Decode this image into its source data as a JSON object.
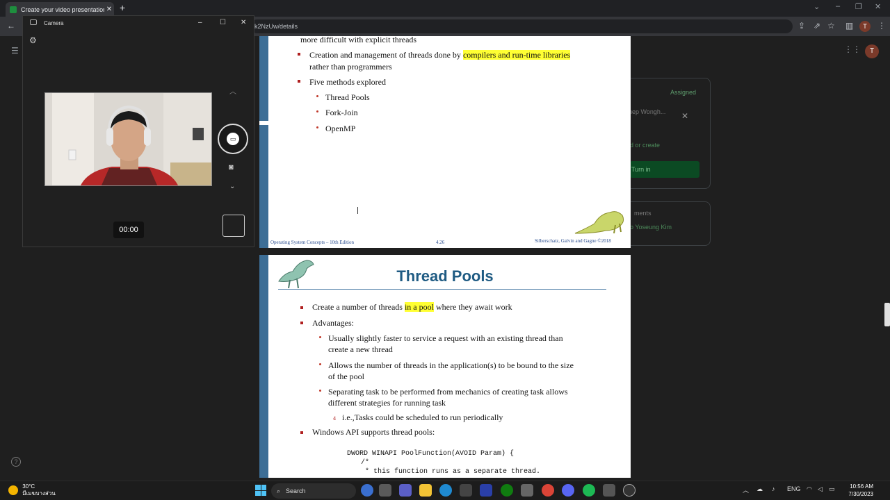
{
  "browser": {
    "tab_title": "Create your video presentation f",
    "url": "k2NzUw/details",
    "avatar_letter": "T"
  },
  "classroom": {
    "assigned": "Assigned",
    "user_name": "hep Wongh...",
    "add_or_create": "d or create",
    "turn_in": "Turn in",
    "comments": "ments",
    "add_comment": "o Yoseung Kim",
    "avatar_letter": "T"
  },
  "slide1": {
    "line0": "more difficult with explicit threads",
    "b1_pre": "Creation and management of threads done by ",
    "b1_hl": "compilers and run-time libraries",
    "b1_line2": "rather than programmers",
    "b2": "Five methods explored",
    "sub": [
      "Thread Pools",
      "Fork-Join",
      "OpenMP"
    ],
    "footer_left": "Operating System Concepts – 10th Edition",
    "footer_mid": "4.26",
    "footer_right": "Silberschatz, Galvin and Gagne ©2018"
  },
  "slide2": {
    "title": "Thread Pools",
    "b1_pre": "Create a number of threads ",
    "b1_hl": "in a pool",
    "b1_post": " where they await work",
    "b2": "Advantages:",
    "s1_l1": "Usually slightly faster to service a request with an existing thread than",
    "s1_l2": "create a new thread",
    "s2_l1": "Allows the number of threads in the application(s) to be bound to the size",
    "s2_l2": "of the pool",
    "s3_l1": "Separating task to be performed from mechanics of creating task allows",
    "s3_l2": "different strategies for running task",
    "ss_marker": "4",
    "ss1": "i.e.,Tasks could be scheduled to run periodically",
    "b3": "Windows API supports thread pools:",
    "code1": "DWORD WINAPI PoolFunction(AVOID Param) {",
    "code2": "/*",
    "code3": " * this function runs as a separate thread."
  },
  "camera": {
    "title": "Camera",
    "timer": "00:00"
  },
  "taskbar": {
    "temp": "30°C",
    "weather_desc": "มีเมฆบางส่วน",
    "search": "Search",
    "lang": "ENG",
    "time": "10:56 AM",
    "date": "7/30/2023"
  },
  "colors": {
    "highlight": "#ffff33",
    "slide_title": "#1f5b83",
    "bullet": "#b02020",
    "turnin_bg": "#0b4a23"
  }
}
